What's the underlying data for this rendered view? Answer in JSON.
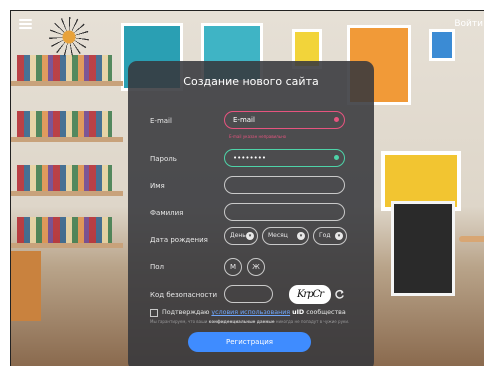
{
  "header": {
    "login_label": "Войти"
  },
  "form": {
    "title": "Создание нового сайта",
    "email": {
      "label": "E-mail",
      "value": "E-mail",
      "error": "E-mail указан неправильно"
    },
    "password": {
      "label": "Пароль",
      "value": "••••••••"
    },
    "first_name": {
      "label": "Имя",
      "value": ""
    },
    "last_name": {
      "label": "Фамилия",
      "value": ""
    },
    "birthdate": {
      "label": "Дата рождения",
      "day": "День",
      "month": "Месяц",
      "year": "Год"
    },
    "gender": {
      "label": "Пол",
      "male": "М",
      "female": "Ж"
    },
    "security": {
      "label": "Код безопасности",
      "value": "",
      "captcha_text": "KrpCr"
    },
    "agree": {
      "prefix": "Подтверждаю",
      "link": "условия использования",
      "brand": "uID",
      "suffix": "сообщества"
    },
    "privacy_note_1": "Мы гарантируем, что ваши",
    "privacy_note_bold": "конфиденциальные данные",
    "privacy_note_2": "никогда не попадут в чужие руки.",
    "submit_label": "Регистрация"
  },
  "colors": {
    "accent": "#3f8cff",
    "error": "#e7547f",
    "success": "#4ed3a8",
    "panel": "#37383c"
  }
}
